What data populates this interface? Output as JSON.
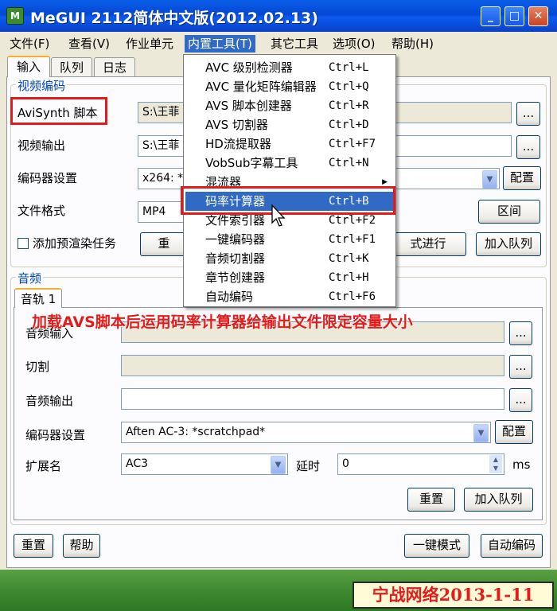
{
  "window": {
    "app_icon_text": "M",
    "title": "MeGUI 2112简体中文版(2012.02.13)"
  },
  "menu": [
    "文件(F)",
    "查看(V)",
    "作业单元",
    "内置工具(T)",
    "其它工具",
    "选项(O)",
    "帮助(H)"
  ],
  "tabs": [
    "输入",
    "队列",
    "日志"
  ],
  "video": {
    "group_title": "视频编码",
    "avisynth_label": "AviSynth 脚本",
    "avisynth_value": "S:\\王菲",
    "output_label": "视频输出",
    "output_value": "S:\\王菲",
    "encoder_label": "编码器设置",
    "encoder_value": "x264: *",
    "config_button": "配置",
    "format_label": "文件格式",
    "format_value": "MP4",
    "range_button": "区间",
    "prerender_label": "添加预渲染任务",
    "reset_button_partial": "重",
    "run_button_partial": "式进行",
    "enqueue_button": "加入队列",
    "browse": "..."
  },
  "audio": {
    "group_title": "音频",
    "track_tab": "音轨 1",
    "input_label": "音频输入",
    "cut_label": "切割",
    "output_label": "音频输出",
    "encoder_label": "编码器设置",
    "encoder_value": "Aften AC-3: *scratchpad*",
    "config_button": "配置",
    "ext_label": "扩展名",
    "ext_value": "AC3",
    "delay_label": "延时",
    "delay_value": "0",
    "delay_unit": "ms",
    "reset_button": "重置",
    "enqueue_button": "加入队列",
    "browse": "..."
  },
  "bottom": {
    "reset": "重置",
    "help": "帮助",
    "oneclick_mode": "一键模式",
    "auto_encode": "自动编码"
  },
  "tools_menu": [
    {
      "label": "AVC 级别检测器",
      "shortcut": "Ctrl+L"
    },
    {
      "label": "AVC 量化矩阵编辑器",
      "shortcut": "Ctrl+Q"
    },
    {
      "label": "AVS 脚本创建器",
      "shortcut": "Ctrl+R"
    },
    {
      "label": "AVS 切割器",
      "shortcut": "Ctrl+D"
    },
    {
      "label": "HD流提取器",
      "shortcut": "Ctrl+F7"
    },
    {
      "label": "VobSub字幕工具",
      "shortcut": "Ctrl+N"
    },
    {
      "label": "混流器",
      "shortcut": ""
    },
    {
      "label": "码率计算器",
      "shortcut": "Ctrl+B"
    },
    {
      "label": "文件索引器",
      "shortcut": "Ctrl+F2"
    },
    {
      "label": "一键编码器",
      "shortcut": "Ctrl+F1"
    },
    {
      "label": "音频切割器",
      "shortcut": "Ctrl+K"
    },
    {
      "label": "章节创建器",
      "shortcut": "Ctrl+H"
    },
    {
      "label": "自动编码",
      "shortcut": "Ctrl+F6"
    }
  ],
  "annotation": "加载AVS脚本后运用码率计算器给输出文件限定容量大小",
  "watermark": "宁战网络2013-1-11",
  "icons": {
    "minimize": "minimize-icon",
    "maximize": "maximize-icon",
    "close": "close-icon",
    "dropdown": "chevron-down-icon",
    "submenu": "chevron-right-icon",
    "cursor": "mouse-pointer-icon"
  },
  "colors": {
    "titlebar": "#0348d4",
    "menu_highlight": "#316ac5",
    "group_title": "#0046d5",
    "annotation_red": "#e41b1b"
  }
}
